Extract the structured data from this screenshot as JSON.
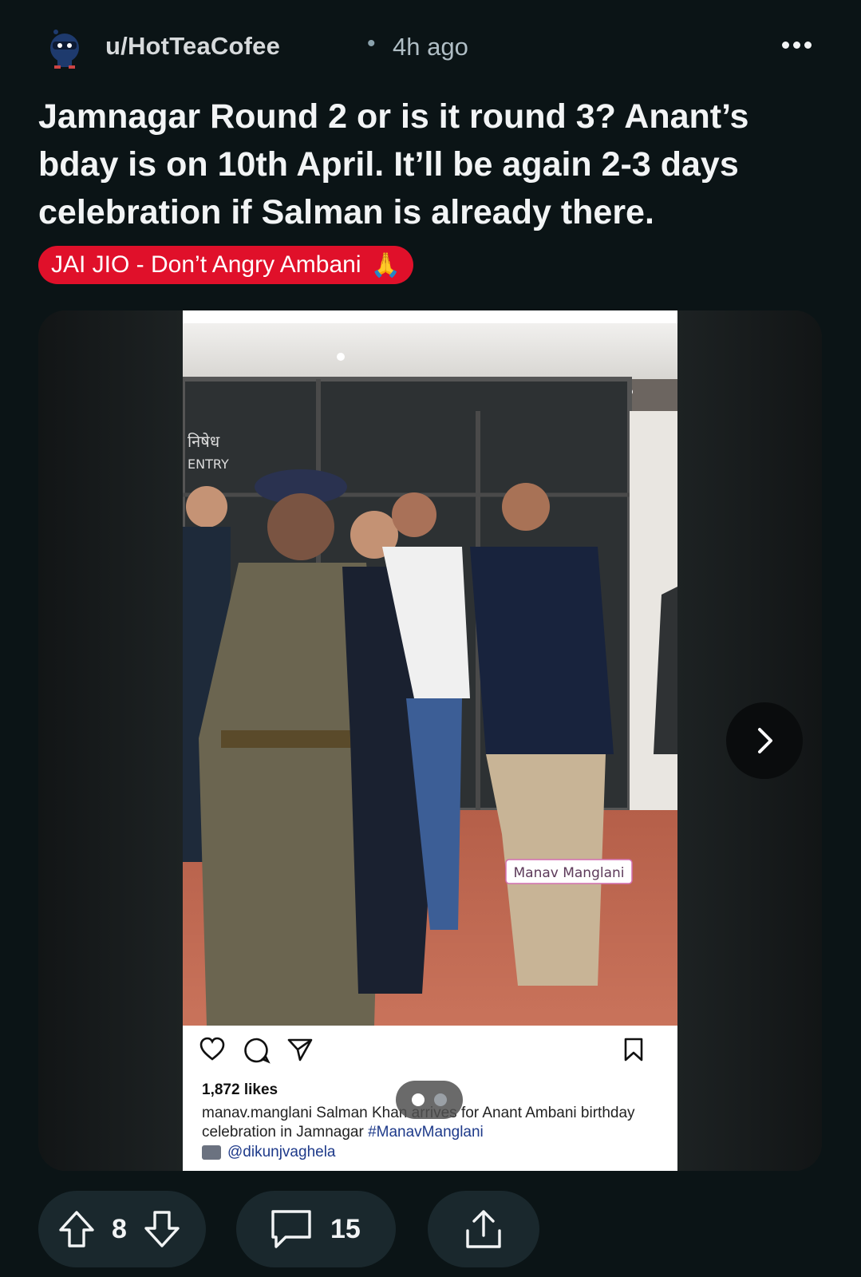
{
  "post": {
    "username": "u/HotTeaCofee",
    "separator": "•",
    "time_ago": "4h ago",
    "title": "Jamnagar Round 2 or is it round 3? Anant’s bday is on 10th April. It’ll be again 2-3 days celebration if Salman is already there.",
    "flair": "JAI JIO - Don’t Angry Ambani",
    "flair_emoji": "🙏",
    "flair_color": "#e0102a"
  },
  "media": {
    "ig_post": {
      "watermark": "Manav Manglani",
      "sign_text_hindi": "निषेध",
      "sign_text_en": "ENTRY",
      "likes": "1,872 likes",
      "caption_user": "manav.manglani",
      "caption_text": "Salman Khan arrives for Anant Ambani birthday celebration in Jamnagar",
      "hashtag": "#ManavManglani",
      "credit": "@dikunjvaghela"
    }
  },
  "actions": {
    "votes": "8",
    "comments": "15"
  },
  "colors": {
    "background": "#0b1416",
    "pill_bg": "#1a282d"
  }
}
